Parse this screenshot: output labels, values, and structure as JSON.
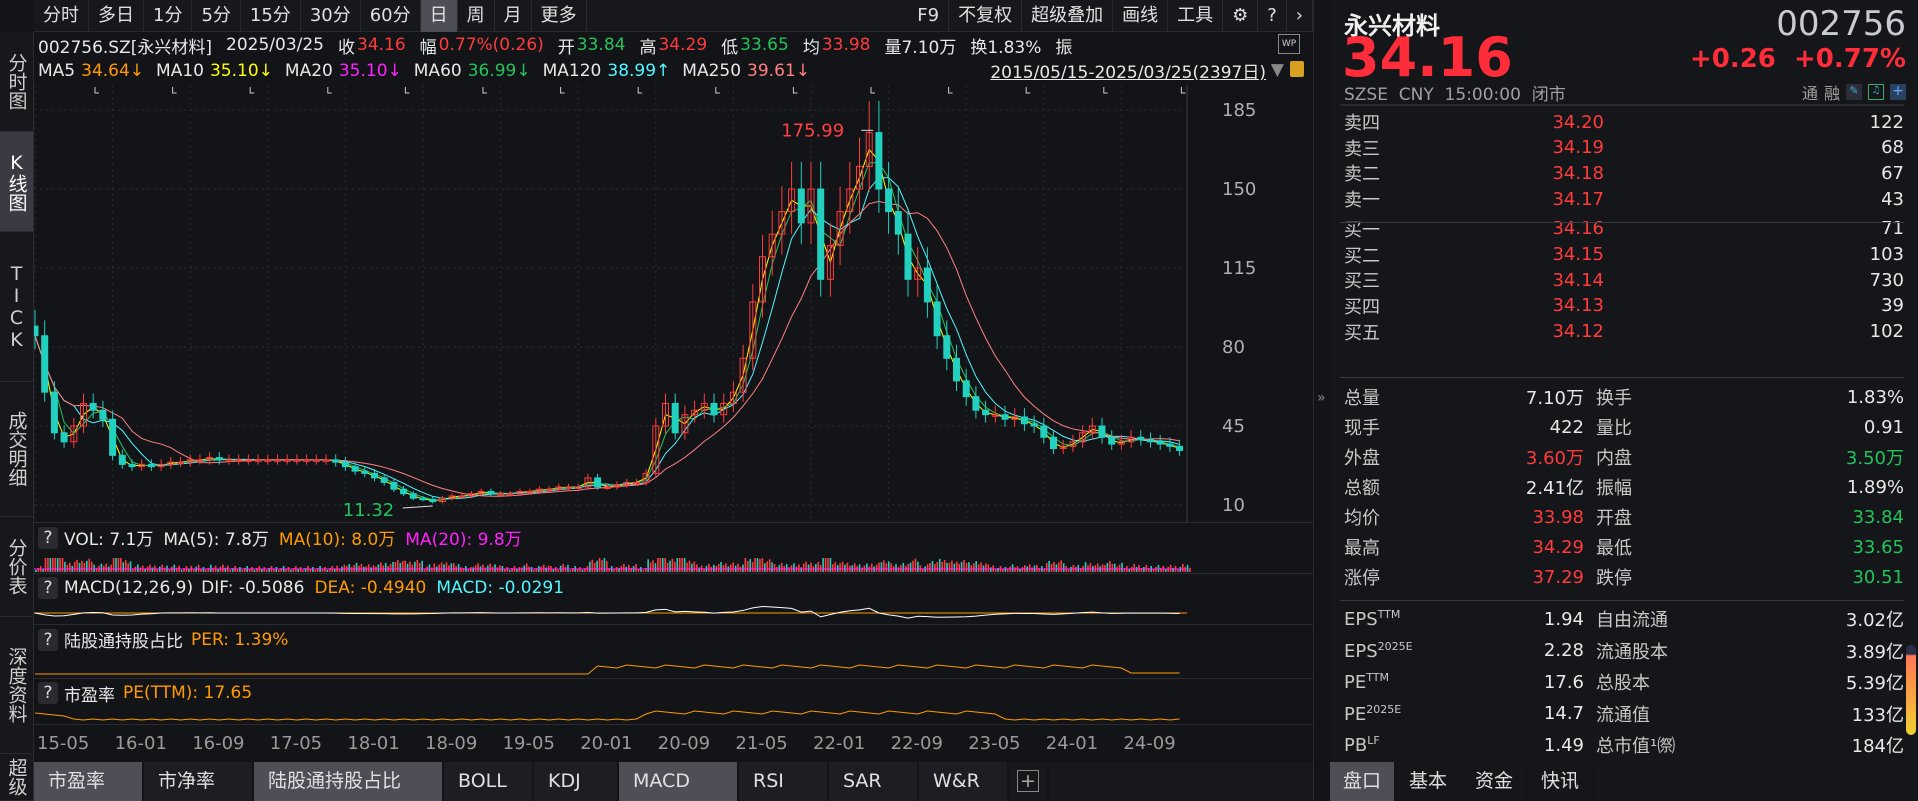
{
  "toolbar": {
    "periods": [
      "分时",
      "多日",
      "1分",
      "5分",
      "15分",
      "30分",
      "60分",
      "日",
      "周",
      "月",
      "更多"
    ],
    "active": "日",
    "right": [
      "F9",
      "不复权",
      "超级叠加",
      "画线",
      "工具"
    ]
  },
  "sidebar": [
    "分时图",
    "K线图",
    "TICK",
    "成交明细",
    "分价表",
    "深度资料",
    "超级"
  ],
  "info": {
    "code": "002756.SZ[永兴材料]",
    "date": "2025/03/25",
    "close_label": "收",
    "close": "34.16",
    "chg_label": "幅",
    "chg": "0.77%(0.26)",
    "open_label": "开",
    "open": "33.84",
    "high_label": "高",
    "high": "34.29",
    "low_label": "低",
    "low": "33.65",
    "avg_label": "均",
    "avg": "33.98",
    "vol": "量7.10万",
    "turn": "换1.83%",
    "amp": "振"
  },
  "ma": [
    {
      "name": "MA5",
      "value": "34.64↓",
      "color": "#ff9a00"
    },
    {
      "name": "MA10",
      "value": "35.10↓",
      "color": "#ffff00"
    },
    {
      "name": "MA20",
      "value": "35.10↓",
      "color": "#ff22ff"
    },
    {
      "name": "MA60",
      "value": "36.99↓",
      "color": "#22c45a"
    },
    {
      "name": "MA120",
      "value": "38.99↑",
      "color": "#4ff7ff"
    },
    {
      "name": "MA250",
      "value": "39.61↓",
      "color": "#ff8080"
    }
  ],
  "range": "2015/05/15-2025/03/25(2397日)",
  "chart": {
    "y_ticks": [
      185,
      150,
      115,
      80,
      45,
      10
    ],
    "x_ticks": [
      "15-05",
      "16-01",
      "16-09",
      "17-05",
      "18-01",
      "18-09",
      "19-05",
      "20-01",
      "20-09",
      "21-05",
      "22-01",
      "22-09",
      "23-05",
      "24-01",
      "24-09"
    ],
    "high_label": "175.99",
    "low_label": "11.32",
    "monthly_close": [
      85,
      60,
      42,
      38,
      45,
      55,
      52,
      48,
      32,
      28,
      27,
      28,
      27,
      28,
      29,
      29,
      30,
      30,
      31,
      30,
      30,
      30,
      30,
      30,
      30,
      30,
      30,
      30,
      30,
      30,
      30,
      29,
      27,
      25,
      24,
      22,
      20,
      17,
      15,
      13,
      12.5,
      11.5,
      13,
      14,
      14,
      15,
      16,
      15,
      15,
      15,
      16,
      16,
      17,
      17,
      18,
      18,
      18,
      22,
      18,
      18,
      19,
      20,
      20,
      24,
      45,
      55,
      42,
      50,
      52,
      55,
      50,
      55,
      60,
      75,
      100,
      120,
      130,
      140,
      150,
      135,
      150,
      110,
      125,
      140,
      150,
      160,
      175,
      150,
      140,
      130,
      110,
      115,
      100,
      85,
      75,
      65,
      58,
      52,
      50,
      50,
      48,
      49,
      46,
      45,
      40,
      35,
      36,
      38,
      42,
      45,
      40,
      37,
      38,
      40,
      39,
      38,
      37,
      36,
      34.16
    ]
  },
  "vol": {
    "label": "VOL: 7.1万",
    "ma5": "MA(5): 7.8万",
    "ma10": "MA(10): 8.0万",
    "ma20": "MA(20): 9.8万"
  },
  "macd": {
    "label": "MACD(12,26,9)",
    "dif": "DIF: -0.5086",
    "dea": "DEA: -0.4940",
    "macd": "MACD: -0.0291"
  },
  "hk": {
    "label": "陆股通持股占比",
    "per": "PER: 1.39%"
  },
  "pe": {
    "label": "市盈率",
    "pe": "PE(TTM): 17.65"
  },
  "bottom_tabs": [
    "市盈率",
    "市净率",
    "陆股通持股占比",
    "BOLL",
    "KDJ",
    "MACD",
    "RSI",
    "SAR",
    "W&R"
  ],
  "bottom_active": [
    "市盈率",
    "陆股通持股占比",
    "MACD"
  ],
  "quote": {
    "name": "永兴材料",
    "code": "002756",
    "price": "34.16",
    "change": "+0.26",
    "pct": "+0.77%",
    "market": "SZSE  CNY  15:00:00  闭市",
    "tong": "通",
    "rong": "融"
  },
  "orderbook": [
    {
      "label": "卖四",
      "price": "34.20",
      "vol": "122"
    },
    {
      "label": "卖三",
      "price": "34.19",
      "vol": "68"
    },
    {
      "label": "卖二",
      "price": "34.18",
      "vol": "67"
    },
    {
      "label": "卖一",
      "price": "34.17",
      "vol": "43"
    },
    {
      "label": "买一",
      "price": "34.16",
      "vol": "71"
    },
    {
      "label": "买二",
      "price": "34.15",
      "vol": "103"
    },
    {
      "label": "买三",
      "price": "34.14",
      "vol": "730"
    },
    {
      "label": "买四",
      "price": "34.13",
      "vol": "39"
    },
    {
      "label": "买五",
      "price": "34.12",
      "vol": "102"
    }
  ],
  "stats": [
    {
      "l1": "总量",
      "v1": "7.10万",
      "c1": "#e8e8e8",
      "l2": "换手",
      "v2": "1.83%",
      "c2": "#e8e8e8"
    },
    {
      "l1": "现手",
      "v1": "422",
      "c1": "#e8e8e8",
      "l2": "量比",
      "v2": "0.91",
      "c2": "#e8e8e8"
    },
    {
      "l1": "外盘",
      "v1": "3.60万",
      "c1": "#ff3b3b",
      "l2": "内盘",
      "v2": "3.50万",
      "c2": "#22c45a"
    },
    {
      "l1": "总额",
      "v1": "2.41亿",
      "c1": "#e8e8e8",
      "l2": "振幅",
      "v2": "1.89%",
      "c2": "#e8e8e8"
    },
    {
      "l1": "均价",
      "v1": "33.98",
      "c1": "#ff3b3b",
      "l2": "开盘",
      "v2": "33.84",
      "c2": "#22c45a"
    },
    {
      "l1": "最高",
      "v1": "34.29",
      "c1": "#ff3b3b",
      "l2": "最低",
      "v2": "33.65",
      "c2": "#22c45a"
    },
    {
      "l1": "涨停",
      "v1": "37.29",
      "c1": "#ff3b3b",
      "l2": "跌停",
      "v2": "30.51",
      "c2": "#22c45a"
    }
  ],
  "fundamentals": [
    {
      "l1": "EPS",
      "s1": "TTM",
      "v1": "1.94",
      "l2": "自由流通",
      "v2": "3.02亿"
    },
    {
      "l1": "EPS",
      "s1": "2025E",
      "v1": "2.28",
      "l2": "流通股本",
      "v2": "3.89亿"
    },
    {
      "l1": "PE",
      "s1": "TTM",
      "v1": "17.6",
      "l2": "总股本",
      "v2": "5.39亿"
    },
    {
      "l1": "PE",
      "s1": "2025E",
      "v1": "14.7",
      "l2": "流通值",
      "v2": "133亿"
    },
    {
      "l1": "PB",
      "s1": "LF",
      "v1": "1.49",
      "l2": "总市值¹㉀",
      "v2": "184亿"
    }
  ],
  "right_tabs": [
    "盘口",
    "基本",
    "资金",
    "快讯"
  ],
  "right_active": "盘口"
}
